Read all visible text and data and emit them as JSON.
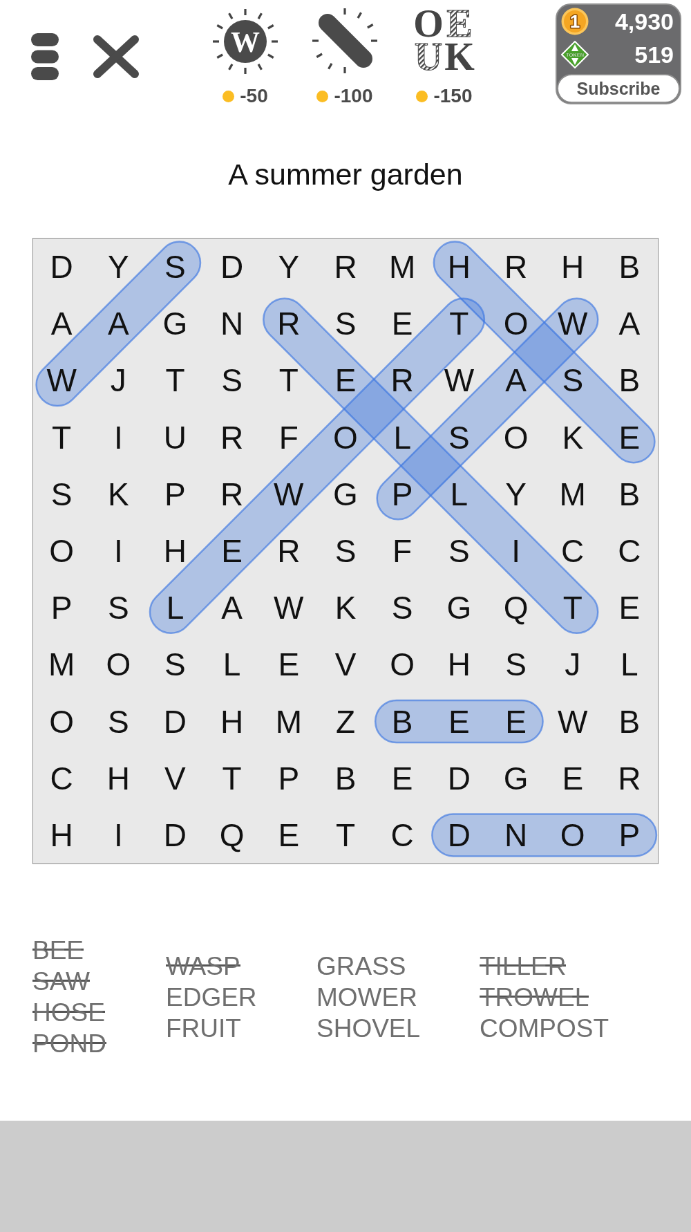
{
  "top_bar": {
    "hints": [
      {
        "kind": "sun",
        "glyph": "W",
        "cost": "-50"
      },
      {
        "kind": "wand",
        "cost": "-100"
      },
      {
        "kind": "letters",
        "glyphs": [
          {
            "char": "O",
            "hatched": false
          },
          {
            "char": "E",
            "hatched": true
          },
          {
            "char": "U",
            "hatched": true
          },
          {
            "char": "K",
            "hatched": false
          }
        ],
        "cost": "-150"
      }
    ],
    "wallet": {
      "coins": {
        "glyph": "1",
        "amount": "4,930"
      },
      "tokens": {
        "label": "TOKEN",
        "amount": "519"
      },
      "subscribe_button": "Subscribe"
    }
  },
  "puzzle_title": "A summer garden",
  "grid": [
    [
      "D",
      "Y",
      "S",
      "D",
      "Y",
      "R",
      "M",
      "H",
      "R",
      "H",
      "B"
    ],
    [
      "A",
      "A",
      "G",
      "N",
      "R",
      "S",
      "E",
      "T",
      "O",
      "W",
      "A"
    ],
    [
      "W",
      "J",
      "T",
      "S",
      "T",
      "E",
      "R",
      "W",
      "A",
      "S",
      "B"
    ],
    [
      "T",
      "I",
      "U",
      "R",
      "F",
      "O",
      "L",
      "S",
      "O",
      "K",
      "E"
    ],
    [
      "S",
      "K",
      "P",
      "R",
      "W",
      "G",
      "P",
      "L",
      "Y",
      "M",
      "B"
    ],
    [
      "O",
      "I",
      "H",
      "E",
      "R",
      "S",
      "F",
      "S",
      "I",
      "C",
      "C"
    ],
    [
      "P",
      "S",
      "L",
      "A",
      "W",
      "K",
      "S",
      "G",
      "Q",
      "T",
      "E"
    ],
    [
      "M",
      "O",
      "S",
      "L",
      "E",
      "V",
      "O",
      "H",
      "S",
      "J",
      "L"
    ],
    [
      "O",
      "S",
      "D",
      "H",
      "M",
      "Z",
      "B",
      "E",
      "E",
      "W",
      "B"
    ],
    [
      "C",
      "H",
      "V",
      "T",
      "P",
      "B",
      "E",
      "D",
      "G",
      "E",
      "R"
    ],
    [
      "H",
      "I",
      "D",
      "Q",
      "E",
      "T",
      "C",
      "D",
      "N",
      "O",
      "P"
    ]
  ],
  "word_columns": [
    {
      "words": [
        {
          "text": "BEE",
          "found": true
        },
        {
          "text": "SAW",
          "found": true
        },
        {
          "text": "HOSE",
          "found": true
        },
        {
          "text": "POND",
          "found": true
        }
      ]
    },
    {
      "words": [
        {
          "text": "WASP",
          "found": true
        },
        {
          "text": "EDGER",
          "found": false
        },
        {
          "text": "FRUIT",
          "found": false
        }
      ]
    },
    {
      "words": [
        {
          "text": "GRASS",
          "found": false
        },
        {
          "text": "MOWER",
          "found": false
        },
        {
          "text": "SHOVEL",
          "found": false
        }
      ]
    },
    {
      "words": [
        {
          "text": "TILLER",
          "found": true
        },
        {
          "text": "TROWEL",
          "found": true
        },
        {
          "text": "COMPOST",
          "found": false
        }
      ]
    }
  ]
}
